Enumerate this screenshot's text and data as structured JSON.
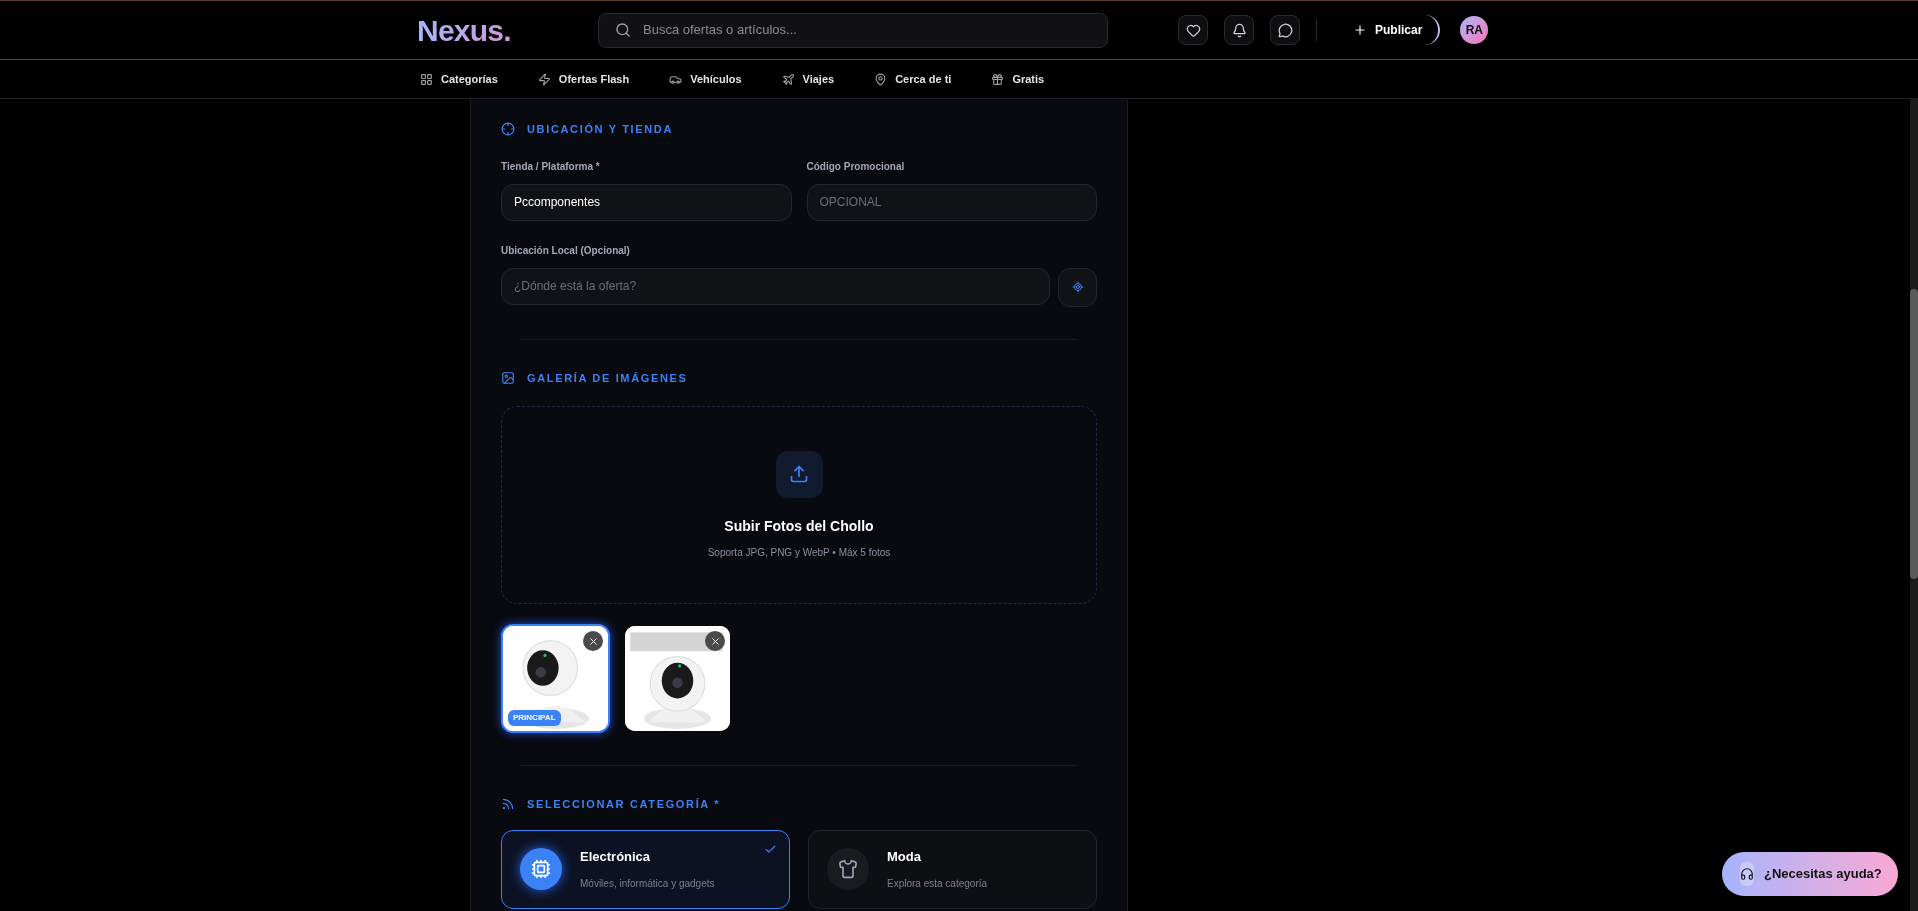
{
  "header": {
    "logo": {
      "text": "Nexus",
      "dot": "."
    },
    "search": {
      "placeholder": "Busca ofertas o artículos..."
    },
    "publish_button": "Publicar",
    "avatar": "RA"
  },
  "nav": [
    {
      "kind": "grid",
      "label": "Categorías"
    },
    {
      "kind": "flash",
      "label": "Ofertas Flash"
    },
    {
      "kind": "car",
      "label": "Vehículos"
    },
    {
      "kind": "plane",
      "label": "Viajes"
    },
    {
      "kind": "pin",
      "label": "Cerca de ti"
    },
    {
      "kind": "gift",
      "label": "Gratis"
    }
  ],
  "location_section": {
    "title": "UBICACIÓN Y TIENDA",
    "store": {
      "label": "Tienda / Plataforma *",
      "value": "Pccomponentes"
    },
    "promo_code": {
      "label": "Código Promocional",
      "placeholder": "OPCIONAL"
    },
    "local": {
      "label": "Ubicación Local (Opcional)",
      "placeholder": "¿Dónde está la oferta?"
    }
  },
  "gallery_section": {
    "title": "GALERÍA DE IMÁGENES",
    "upload_title": "Subir Fotos del Chollo",
    "upload_hint": "Soporta JPG, PNG y WebP • Máx 5 fotos",
    "images": [
      {
        "kind": "picture",
        "principal": true,
        "badge": "PRINCIPAL"
      },
      {
        "kind": "picture",
        "principal": false
      }
    ]
  },
  "category_section": {
    "title": "SELECCIONAR CATEGORÍA *",
    "categories": [
      {
        "kind": "chip",
        "name": "Electrónica",
        "description": "Móviles, informática y gadgets",
        "selected": true
      },
      {
        "kind": "shirt",
        "name": "Moda",
        "description": "Explora esta categoría",
        "selected": false
      }
    ]
  },
  "help_button": "¿Necesitas ayuda?"
}
